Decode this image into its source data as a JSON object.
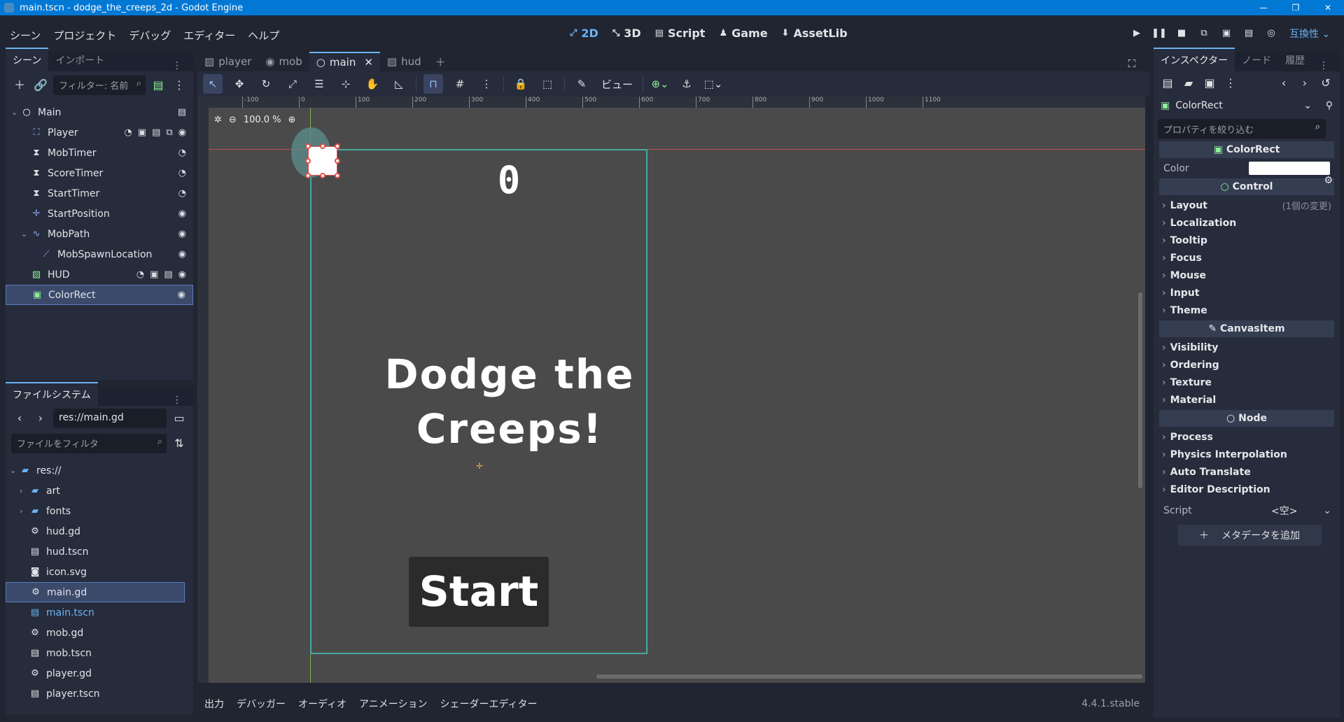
{
  "window": {
    "title": "main.tscn - dodge_the_creeps_2d - Godot Engine",
    "controls": [
      "—",
      "❐",
      "✕"
    ]
  },
  "menu": [
    "シーン",
    "プロジェクト",
    "デバッグ",
    "エディター",
    "ヘルプ"
  ],
  "main_tabs": [
    {
      "label": "2D",
      "icon": "2d-icon",
      "glyph": "⤢"
    },
    {
      "label": "3D",
      "icon": "3d-icon",
      "glyph": "⤡"
    },
    {
      "label": "Script",
      "icon": "script-icon",
      "glyph": "▤"
    },
    {
      "label": "Game",
      "icon": "game-icon",
      "glyph": "♟"
    },
    {
      "label": "AssetLib",
      "icon": "assetlib-icon",
      "glyph": "⬇"
    }
  ],
  "compat_label": "互換性",
  "scene_dock": {
    "tabs": [
      "シーン",
      "インポート"
    ],
    "filter_placeholder": "フィルター: 名前",
    "tree": [
      {
        "label": "Main",
        "indent": 0,
        "expand": "⌄",
        "icon": "○",
        "badges": [
          "▤"
        ]
      },
      {
        "label": "Player",
        "indent": 1,
        "icon": "⛶",
        "badges": [
          "◔",
          "▣",
          "▤",
          "⧉",
          "◉"
        ]
      },
      {
        "label": "MobTimer",
        "indent": 1,
        "icon": "⧗",
        "badges": [
          "◔"
        ]
      },
      {
        "label": "ScoreTimer",
        "indent": 1,
        "icon": "⧗",
        "badges": [
          "◔"
        ]
      },
      {
        "label": "StartTimer",
        "indent": 1,
        "icon": "⧗",
        "badges": [
          "◔"
        ]
      },
      {
        "label": "StartPosition",
        "indent": 1,
        "icon": "✛",
        "badges": [
          "◉"
        ]
      },
      {
        "label": "MobPath",
        "indent": 1,
        "expand": "⌄",
        "icon": "∿",
        "badges": [
          "◉"
        ]
      },
      {
        "label": "MobSpawnLocation",
        "indent": 2,
        "icon": "⟋",
        "badges": [
          "◉"
        ]
      },
      {
        "label": "HUD",
        "indent": 1,
        "icon": "▨",
        "badges": [
          "◔",
          "▣",
          "▤",
          "◉"
        ]
      },
      {
        "label": "ColorRect",
        "indent": 1,
        "icon": "▣",
        "badges": [
          "◉"
        ],
        "selected": true
      }
    ]
  },
  "filesystem": {
    "tab": "ファイルシステム",
    "path": "res://main.gd",
    "filter_placeholder": "ファイルをフィルタ",
    "items": [
      {
        "label": "res://",
        "indent": 0,
        "icon": "▰",
        "folder": true,
        "expand": "⌄"
      },
      {
        "label": "art",
        "indent": 1,
        "icon": "▰",
        "folder": true,
        "expand": "›"
      },
      {
        "label": "fonts",
        "indent": 1,
        "icon": "▰",
        "folder": true,
        "expand": "›"
      },
      {
        "label": "hud.gd",
        "indent": 1,
        "icon": "⚙"
      },
      {
        "label": "hud.tscn",
        "indent": 1,
        "icon": "▤"
      },
      {
        "label": "icon.svg",
        "indent": 1,
        "icon": "◙"
      },
      {
        "label": "main.gd",
        "indent": 1,
        "icon": "⚙",
        "selected": true
      },
      {
        "label": "main.tscn",
        "indent": 1,
        "icon": "▤",
        "link": true
      },
      {
        "label": "mob.gd",
        "indent": 1,
        "icon": "⚙"
      },
      {
        "label": "mob.tscn",
        "indent": 1,
        "icon": "▤"
      },
      {
        "label": "player.gd",
        "indent": 1,
        "icon": "⚙"
      },
      {
        "label": "player.tscn",
        "indent": 1,
        "icon": "▤"
      }
    ]
  },
  "editor_tabs": [
    {
      "label": "player",
      "icon": "▨"
    },
    {
      "label": "mob",
      "icon": "◉"
    },
    {
      "label": "main",
      "icon": "○",
      "active": true,
      "close": "✕"
    },
    {
      "label": "hud",
      "icon": "▨"
    }
  ],
  "editor_toolbar": {
    "view_label": "ビュー"
  },
  "viewport": {
    "zoom": "100.0 %",
    "ruler_ticks": [
      "-100",
      "0",
      "100",
      "200",
      "300",
      "400",
      "500",
      "600",
      "700",
      "800",
      "900",
      "1000",
      "1100"
    ],
    "score": "0",
    "title_line1": "Dodge the",
    "title_line2": "Creeps!",
    "start": "Start"
  },
  "bottom_panel": {
    "tabs": [
      "出力",
      "デバッガー",
      "オーディオ",
      "アニメーション",
      "シェーダーエディター"
    ],
    "version": "4.4.1.stable"
  },
  "inspector": {
    "tabs": [
      "インスペクター",
      "ノード",
      "履歴"
    ],
    "object": "ColorRect",
    "filter_placeholder": "プロパティを絞り込む",
    "sections": {
      "colorrect": "ColorRect",
      "control": "Control",
      "canvasitem": "CanvasItem",
      "node": "Node"
    },
    "color_label": "Color",
    "color_value": "#ffffff",
    "control_groups": [
      {
        "label": "Layout",
        "note": "(1個の変更)"
      },
      {
        "label": "Localization"
      },
      {
        "label": "Tooltip"
      },
      {
        "label": "Focus"
      },
      {
        "label": "Mouse"
      },
      {
        "label": "Input"
      },
      {
        "label": "Theme"
      }
    ],
    "canvas_groups": [
      {
        "label": "Visibility"
      },
      {
        "label": "Ordering"
      },
      {
        "label": "Texture"
      },
      {
        "label": "Material"
      }
    ],
    "node_groups": [
      {
        "label": "Process"
      },
      {
        "label": "Physics Interpolation"
      },
      {
        "label": "Auto Translate"
      },
      {
        "label": "Editor Description"
      }
    ],
    "script_label": "Script",
    "script_value": "<空>",
    "add_meta": "メタデータを追加"
  }
}
